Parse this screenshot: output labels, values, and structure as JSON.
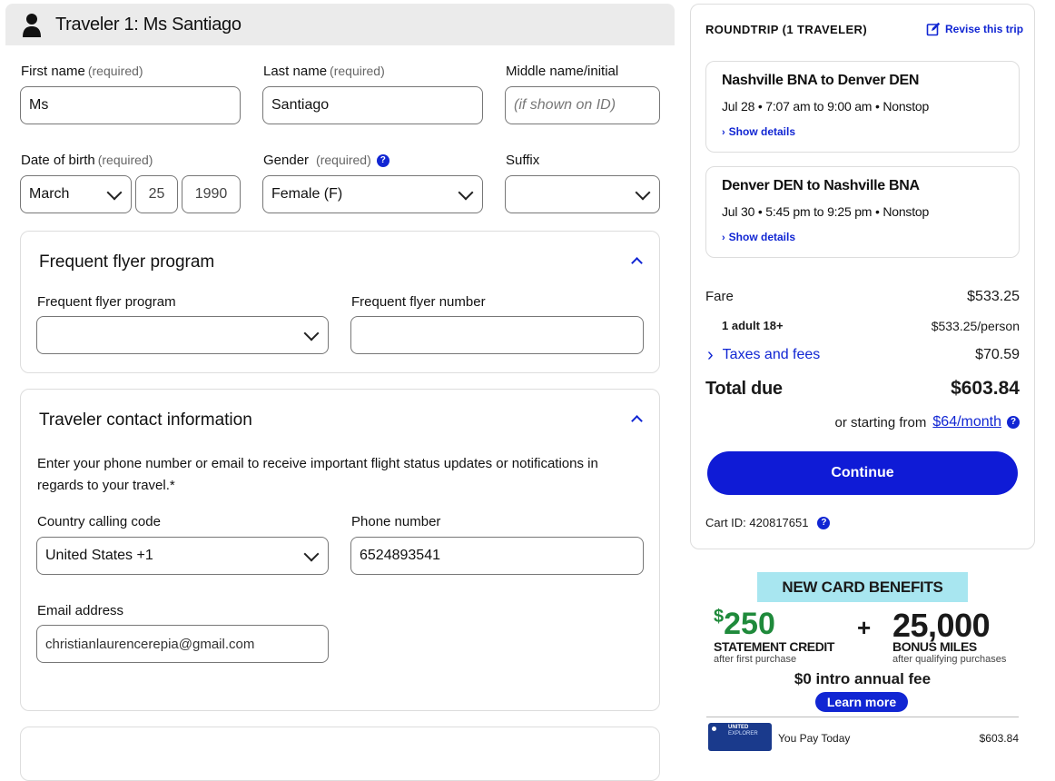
{
  "traveler": {
    "header": "Traveler 1: Ms Santiago"
  },
  "form": {
    "required_tag": "(required)",
    "first_name": {
      "label": "First name",
      "value": "Ms"
    },
    "last_name": {
      "label": "Last name",
      "value": "Santiago"
    },
    "middle_name": {
      "label": "Middle name/initial",
      "placeholder": "(if shown on ID)"
    },
    "dob": {
      "label": "Date of birth",
      "month": "March",
      "day": "25",
      "year": "1990"
    },
    "gender": {
      "label": "Gender",
      "value": "Female (F)"
    },
    "suffix": {
      "label": "Suffix",
      "value": ""
    }
  },
  "frequent_flyer": {
    "title": "Frequent flyer program",
    "program_label": "Frequent flyer program",
    "number_label": "Frequent flyer number"
  },
  "contact": {
    "title": "Traveler contact information",
    "description": "Enter your phone number or email to receive important flight status updates or notifications in regards to your travel.*",
    "country_label": "Country calling code",
    "country_value": "United States +1",
    "phone_label": "Phone number",
    "phone_value": "6524893541",
    "email_label": "Email address",
    "email_value": "christianlaurencerepia@gmail.com"
  },
  "summary": {
    "title": "ROUNDTRIP (1 TRAVELER)",
    "revise_label": "Revise this trip",
    "segments": [
      {
        "route": "Nashville BNA to Denver DEN",
        "time": "Jul 28 • 7:07 am to 9:00 am • Nonstop",
        "details": "Show details"
      },
      {
        "route": "Denver DEN to Nashville BNA",
        "time": "Jul 30 • 5:45 pm to 9:25 pm • Nonstop",
        "details": "Show details"
      }
    ],
    "fare_label": "Fare",
    "fare_value": "$533.25",
    "adult_label": "1 adult 18+",
    "adult_value": "$533.25/person",
    "taxes_label": "Taxes and fees",
    "taxes_value": "$70.59",
    "total_label": "Total due",
    "total_value": "$603.84",
    "monthly_prefix": "or starting from",
    "monthly_value": "$64/month",
    "continue_label": "Continue",
    "cart_label": "Cart ID: 420817651"
  },
  "ad": {
    "banner": "NEW CARD BENEFITS",
    "credit_amount": "250",
    "credit_dollar": "$",
    "credit_title": "STATEMENT CREDIT",
    "credit_sub": "after first purchase",
    "plus": "+",
    "miles_amount": "25,000",
    "miles_title": "BONUS MILES",
    "miles_sub": "after qualifying purchases",
    "annual_fee": "$0 intro annual fee",
    "learn_more": "Learn more",
    "card_brand": "UNITED",
    "card_name": "EXPLORER",
    "pay_today_label": "You Pay Today",
    "pay_today_value": "$603.84"
  },
  "colors": {
    "accent": "#1126d3",
    "banner_bg": "#a8e6f0",
    "continue_bg": "#0f1bd6",
    "card_blue": "#1a3a8c"
  }
}
